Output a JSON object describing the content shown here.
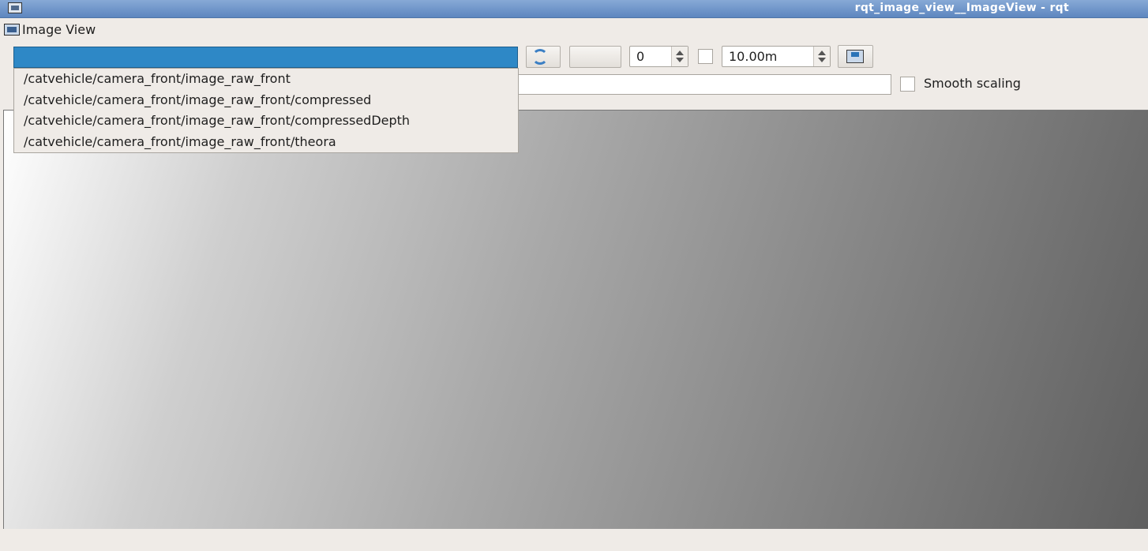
{
  "window": {
    "title": "rqt_image_view__ImageView - rqt"
  },
  "plugin": {
    "title": "Image View"
  },
  "topic_dropdown": {
    "selected": "",
    "options": [
      "/catvehicle/camera_front/image_raw_front",
      "/catvehicle/camera_front/image_raw_front/compressed",
      "/catvehicle/camera_front/image_raw_front/compressedDepth",
      "/catvehicle/camera_front/image_raw_front/theora"
    ]
  },
  "toolbar": {
    "refresh_icon": "refresh-icon",
    "blank_button_label": "",
    "rotation_value": "0",
    "max_range_value": "10.00m",
    "save_icon": "save-icon"
  },
  "smooth_scaling": {
    "label": "Smooth scaling",
    "checked": false
  },
  "colors": {
    "selection": "#2e88c6",
    "titlebar": "#5d86bf",
    "background": "#efebe7"
  }
}
